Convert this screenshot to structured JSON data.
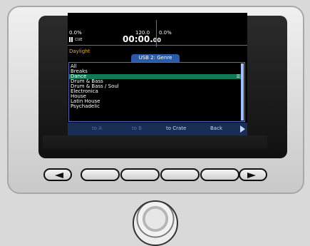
{
  "deck": {
    "left_percent": "0.0%",
    "bpm": "120.0",
    "right_percent": "0.0%",
    "cue_icon": "pause-cue-icon",
    "cue_label": "CUE",
    "time": "00:00.",
    "time_ms": "00"
  },
  "track_name": "Daylight",
  "browser": {
    "tab_label": "USB 2: Genre",
    "items": [
      "All",
      "Breaks",
      "Dance",
      "Drum & Bass",
      "Drum & Bass / Soul",
      "Electronica",
      "House",
      "Latin House",
      "Psychadelic"
    ],
    "selected_index": 2,
    "selected_marker": "☰"
  },
  "softkeys": {
    "labels": [
      "to A",
      "to B",
      "to Crate",
      "Back"
    ],
    "dim": [
      true,
      true,
      false,
      false
    ],
    "play_icon": "play-triangle-icon"
  },
  "hardware": {
    "left_arrow_icon": "left-arrow-icon",
    "right_arrow_icon": "right-arrow-icon",
    "knob_icon": "rotary-knob-icon"
  }
}
